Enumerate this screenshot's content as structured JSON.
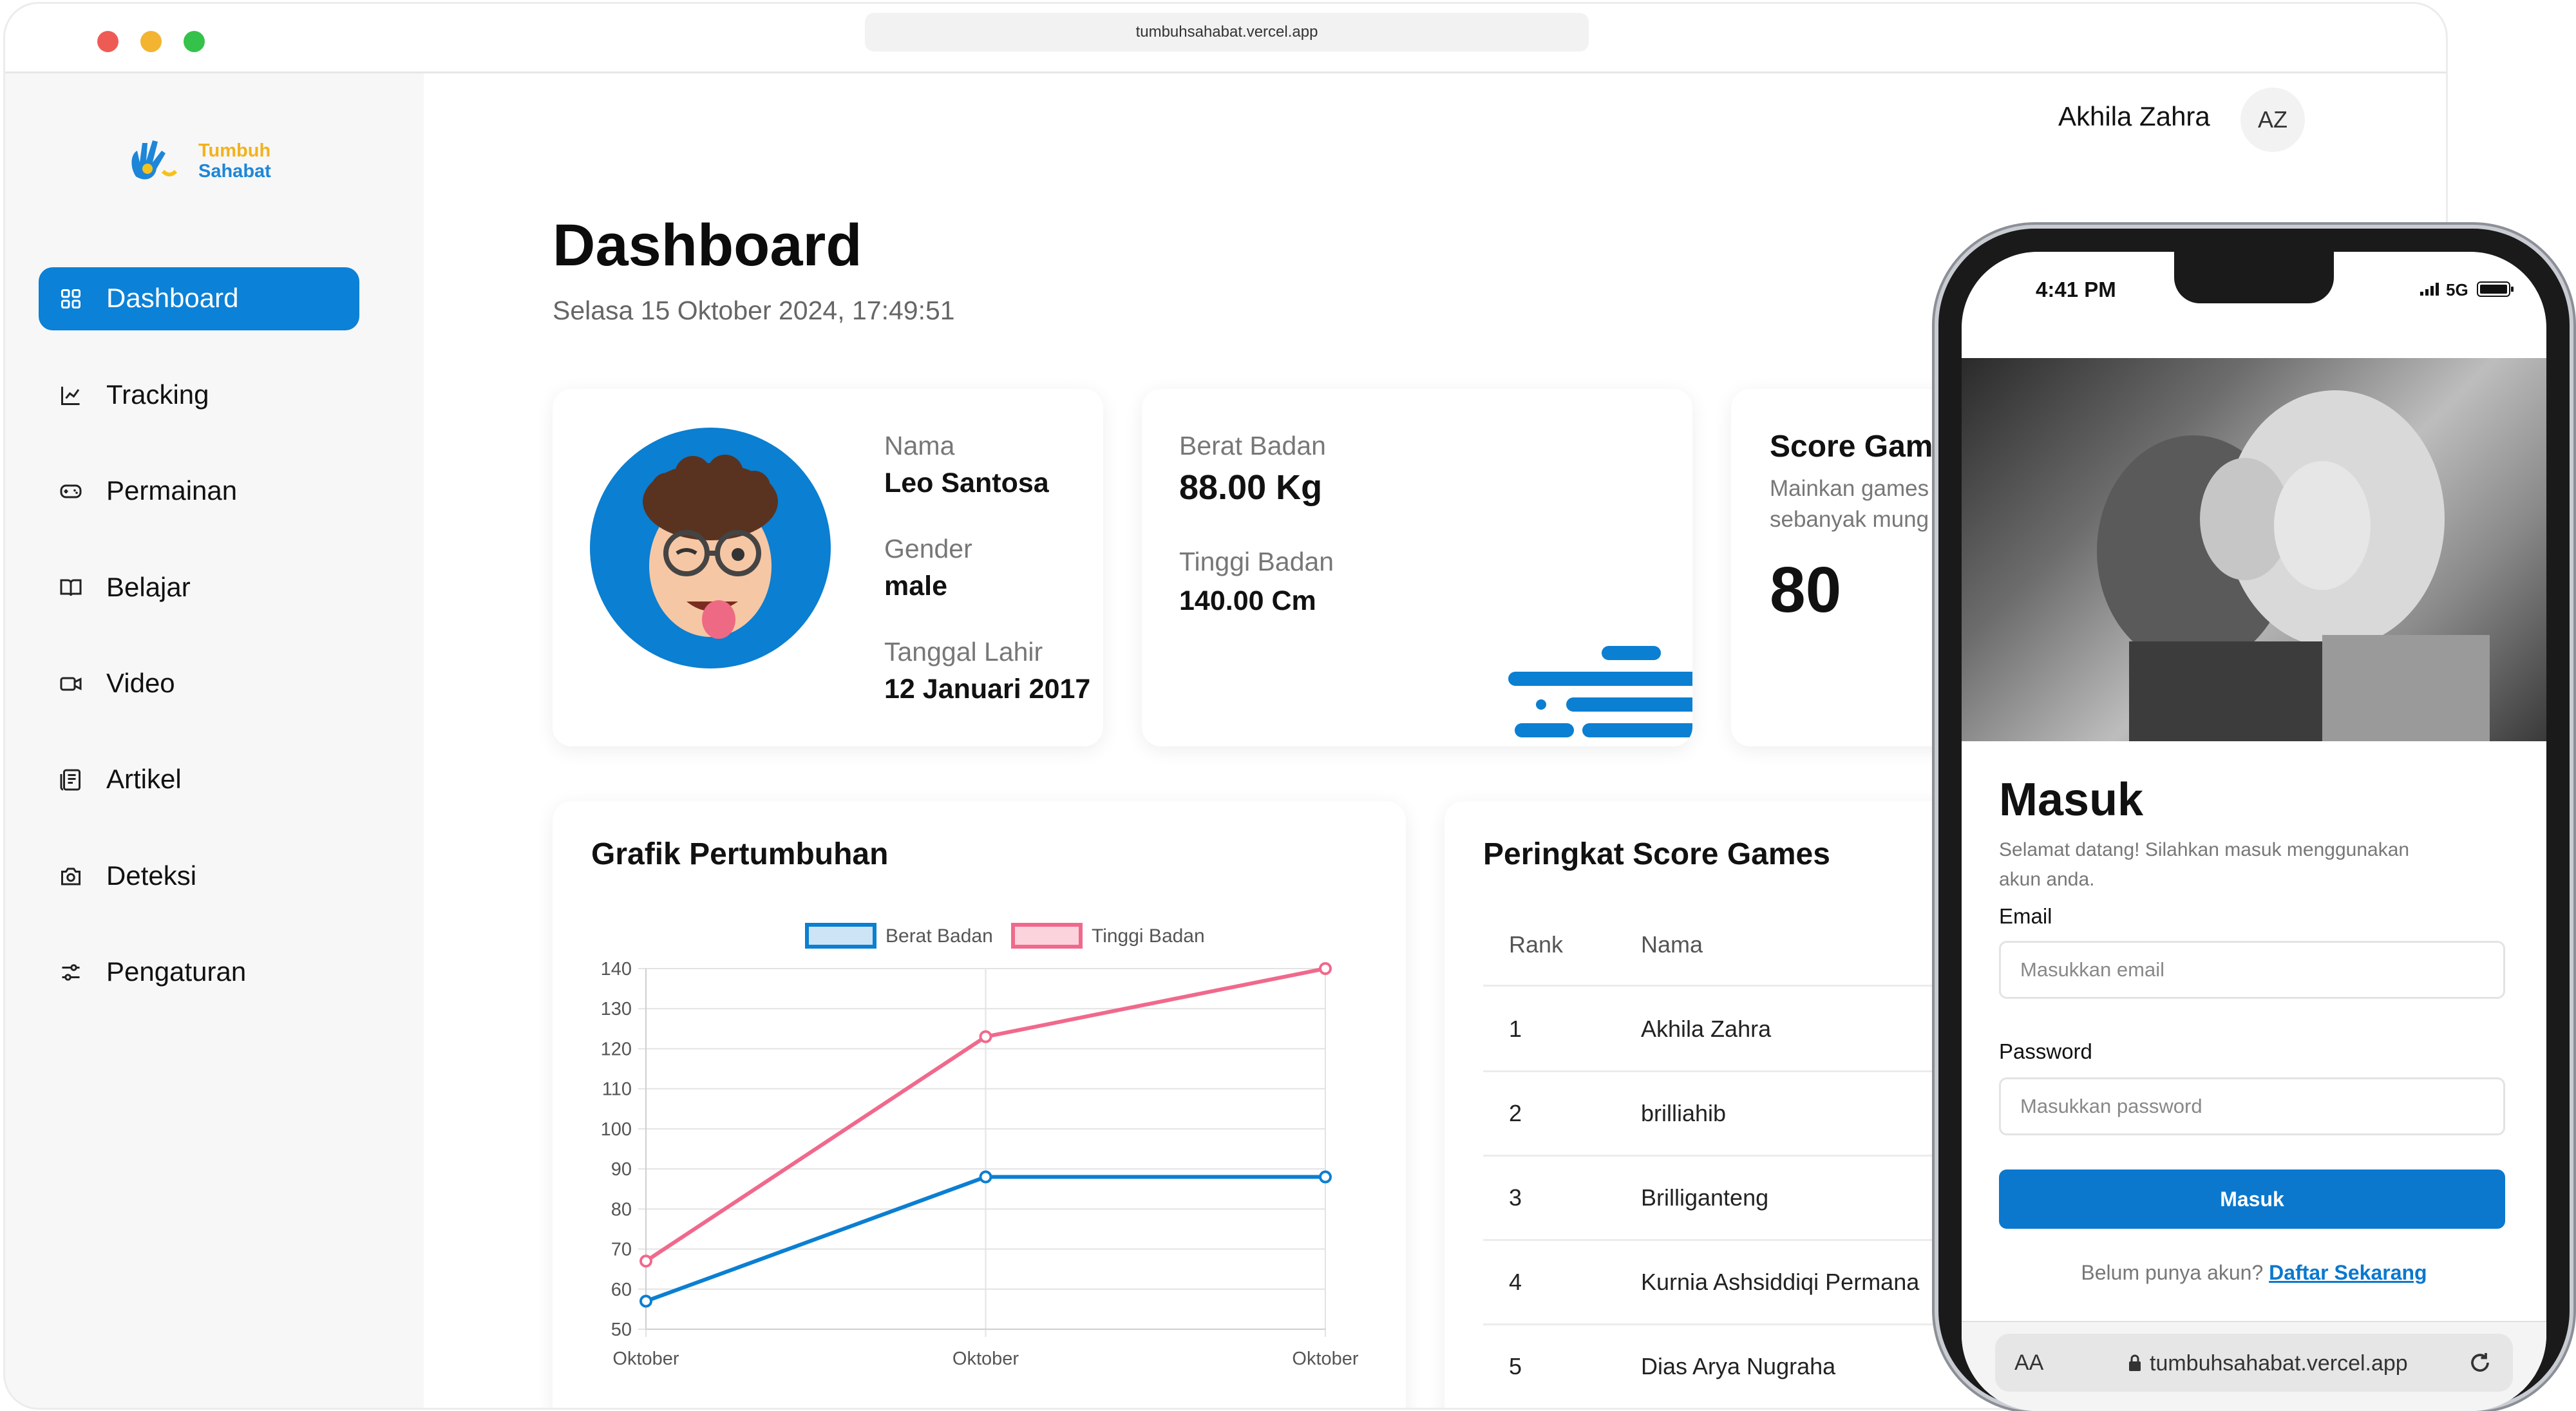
{
  "browser": {
    "url": "tumbuhsahabat.vercel.app"
  },
  "logo": {
    "line1": "Tumbuh",
    "line2": "Sahabat"
  },
  "sidebar": {
    "items": [
      {
        "label": "Dashboard",
        "icon": "dashboard-icon"
      },
      {
        "label": "Tracking",
        "icon": "tracking-chart-icon"
      },
      {
        "label": "Permainan",
        "icon": "gamepad-icon"
      },
      {
        "label": "Belajar",
        "icon": "book-icon"
      },
      {
        "label": "Video",
        "icon": "video-icon"
      },
      {
        "label": "Artikel",
        "icon": "article-icon"
      },
      {
        "label": "Deteksi",
        "icon": "camera-icon"
      },
      {
        "label": "Pengaturan",
        "icon": "settings-sliders-icon"
      }
    ]
  },
  "header": {
    "user_name": "Akhila Zahra",
    "avatar_initials": "AZ"
  },
  "page": {
    "title": "Dashboard",
    "datetime": "Selasa 15 Oktober 2024, 17:49:51"
  },
  "profile": {
    "name_label": "Nama",
    "name": "Leo Santosa",
    "gender_label": "Gender",
    "gender": "male",
    "birth_label": "Tanggal Lahir",
    "birth": "12 Januari 2017"
  },
  "body_stats": {
    "weight_label": "Berat Badan",
    "weight": "88.00 Kg",
    "height_label": "Tinggi Badan",
    "height": "140.00 Cm"
  },
  "score": {
    "title": "Score Game",
    "desc_line1": "Mainkan games",
    "desc_line2": "sebanyak mung",
    "value": "80"
  },
  "growth_chart": {
    "title": "Grafik Pertumbuhan"
  },
  "chart_data": {
    "type": "line",
    "title": "",
    "categories": [
      "Oktober",
      "Oktober",
      "Oktober"
    ],
    "series": [
      {
        "name": "Berat Badan",
        "values": [
          57,
          88,
          88
        ],
        "color": "#0b7fd1"
      },
      {
        "name": "Tinggi Badan",
        "values": [
          67,
          123,
          140
        ],
        "color": "#f0698c"
      }
    ],
    "yticks": [
      50,
      60,
      70,
      80,
      90,
      100,
      110,
      120,
      130,
      140
    ],
    "ylim": [
      50,
      140
    ],
    "grid": true,
    "legend": "top"
  },
  "leaderboard": {
    "title": "Peringkat Score Games",
    "columns": [
      "Rank",
      "Nama"
    ],
    "rows": [
      {
        "rank": "1",
        "name": "Akhila Zahra"
      },
      {
        "rank": "2",
        "name": "brilliahib"
      },
      {
        "rank": "3",
        "name": "Brilliganteng"
      },
      {
        "rank": "4",
        "name": "Kurnia Ashsiddiqi Permana"
      },
      {
        "rank": "5",
        "name": "Dias Arya Nugraha"
      }
    ]
  },
  "phone": {
    "time": "4:41 PM",
    "signal": "5G",
    "login": {
      "title": "Masuk",
      "subtitle_line1": "Selamat datang! Silahkan masuk menggunakan",
      "subtitle_line2": "akun anda.",
      "email_label": "Email",
      "email_placeholder": "Masukkan email",
      "password_label": "Password",
      "password_placeholder": "Masukkan password",
      "button": "Masuk",
      "register_prompt": "Belum punya akun?",
      "register_link": "Daftar Sekarang"
    },
    "bottom_bar": {
      "text_size": "AA",
      "url": "tumbuhsahabat.vercel.app"
    }
  },
  "colors": {
    "primary": "#0b81d7",
    "weight_line": "#0b7fd1",
    "height_line": "#f0698c"
  }
}
